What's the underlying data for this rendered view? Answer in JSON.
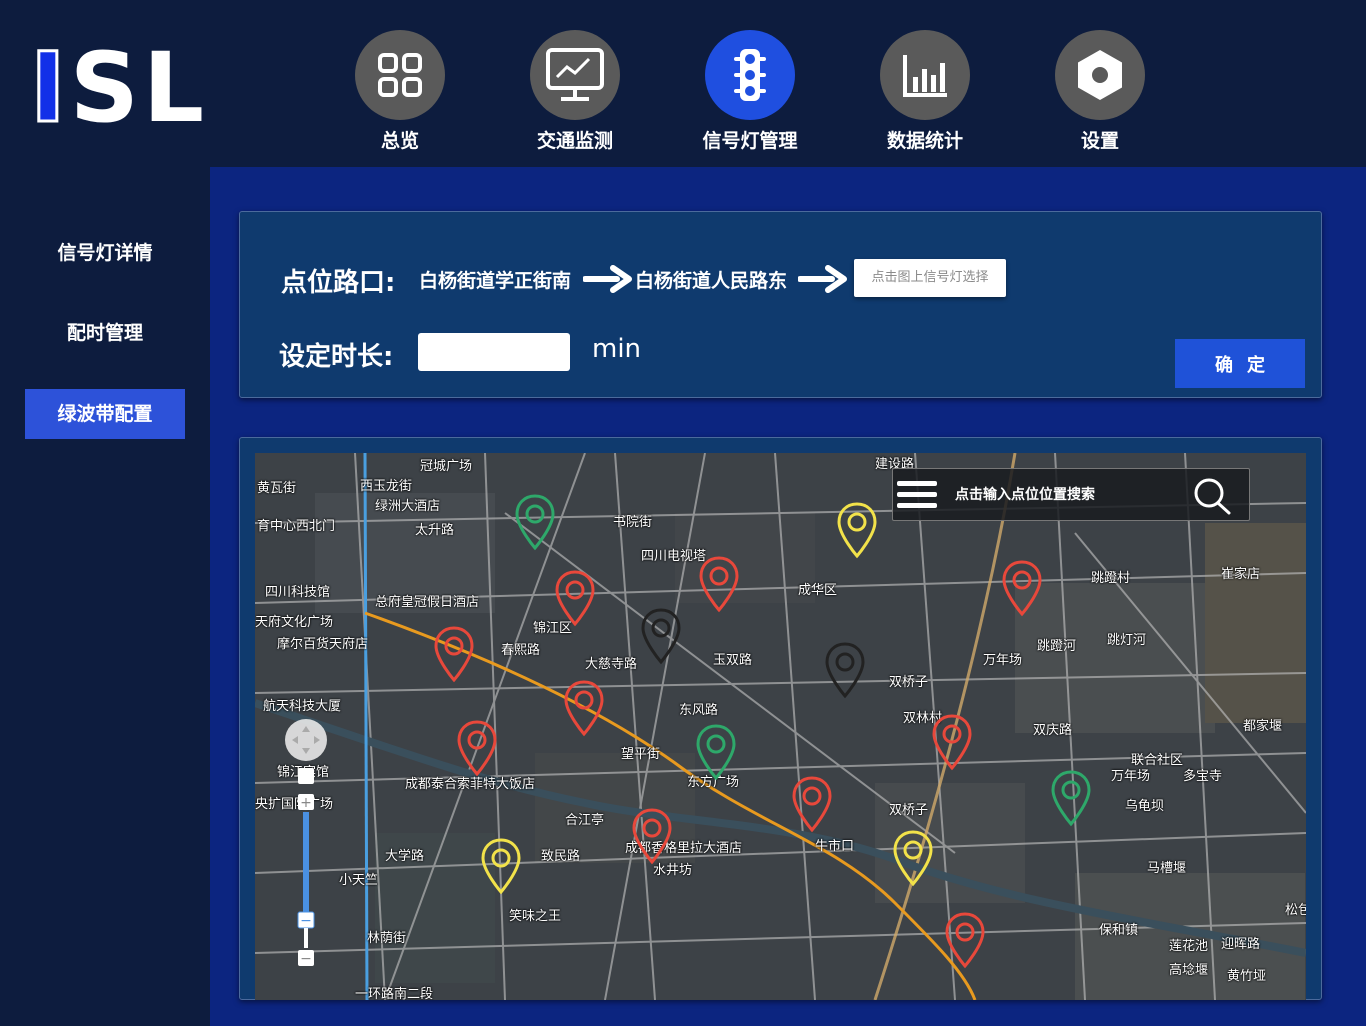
{
  "logo": {
    "letter1": "I",
    "letters": "SL"
  },
  "nav": [
    {
      "label": "总览",
      "icon": "grid-icon",
      "active": false
    },
    {
      "label": "交通监测",
      "icon": "monitor-chart-icon",
      "active": false
    },
    {
      "label": "信号灯管理",
      "icon": "traffic-light-icon",
      "active": true
    },
    {
      "label": "数据统计",
      "icon": "bar-chart-icon",
      "active": false
    },
    {
      "label": "设置",
      "icon": "hexagon-settings-icon",
      "active": false
    }
  ],
  "sidebar": [
    {
      "label": "信号灯详情",
      "active": false
    },
    {
      "label": "配时管理",
      "active": false
    },
    {
      "label": "绿波带配置",
      "active": true
    }
  ],
  "form": {
    "route_label": "点位路口:",
    "route_point1": "白杨街道学正街南",
    "route_point2": "白杨街道人民路东",
    "select_placeholder": "点击图上信号灯选择",
    "duration_label": "设定时长:",
    "duration_value": "",
    "duration_unit": "min",
    "confirm_label": "确定"
  },
  "map": {
    "search_placeholder": "点击输入点位位置搜索",
    "labels": [
      "冠城广场",
      "西玉龙街",
      "黄瓦街",
      "绿洲大酒店",
      "太升路",
      "育中心西北门",
      "书院街",
      "四川电视塔",
      "建设路",
      "四川科技馆",
      "总府皇冠假日酒店",
      "成华区",
      "跳蹬村",
      "崔家店",
      "天府文化广场",
      "摩尔百货天府店",
      "锦江区",
      "春熙路",
      "大慈寺路",
      "玉双路",
      "万年场",
      "跳蹬河",
      "跳灯河",
      "双桥子",
      "航天科技大厦",
      "东风路",
      "双林村",
      "双庆路",
      "都家堰",
      "望平街",
      "东方广场",
      "联合社区",
      "万年场",
      "多宝寺",
      "锦江宾馆",
      "成都泰合索菲特大饭店",
      "双桥子",
      "乌龟坝",
      "央扩国际广场",
      "合江亭",
      "成都香格里拉大酒店",
      "牛市口",
      "马槽堰",
      "大学路",
      "致民路",
      "水井坊",
      "保和镇",
      "小天竺",
      "松包",
      "笑味之王",
      "莲花池",
      "迎晖路",
      "高埝堰",
      "黄竹垭",
      "林荫街",
      "一环路南二段"
    ],
    "colors": {
      "red": "#e8483b",
      "green": "#2ea86a",
      "yellow": "#f2e24a",
      "black": "#222222"
    },
    "markers": [
      {
        "color": "green"
      },
      {
        "color": "yellow"
      },
      {
        "color": "red"
      },
      {
        "color": "red"
      },
      {
        "color": "black"
      },
      {
        "color": "red"
      },
      {
        "color": "black"
      },
      {
        "color": "red"
      },
      {
        "color": "red"
      },
      {
        "color": "red"
      },
      {
        "color": "green"
      },
      {
        "color": "red"
      },
      {
        "color": "red"
      },
      {
        "color": "green"
      },
      {
        "color": "red"
      },
      {
        "color": "yellow"
      },
      {
        "color": "yellow"
      },
      {
        "color": "red"
      }
    ]
  }
}
